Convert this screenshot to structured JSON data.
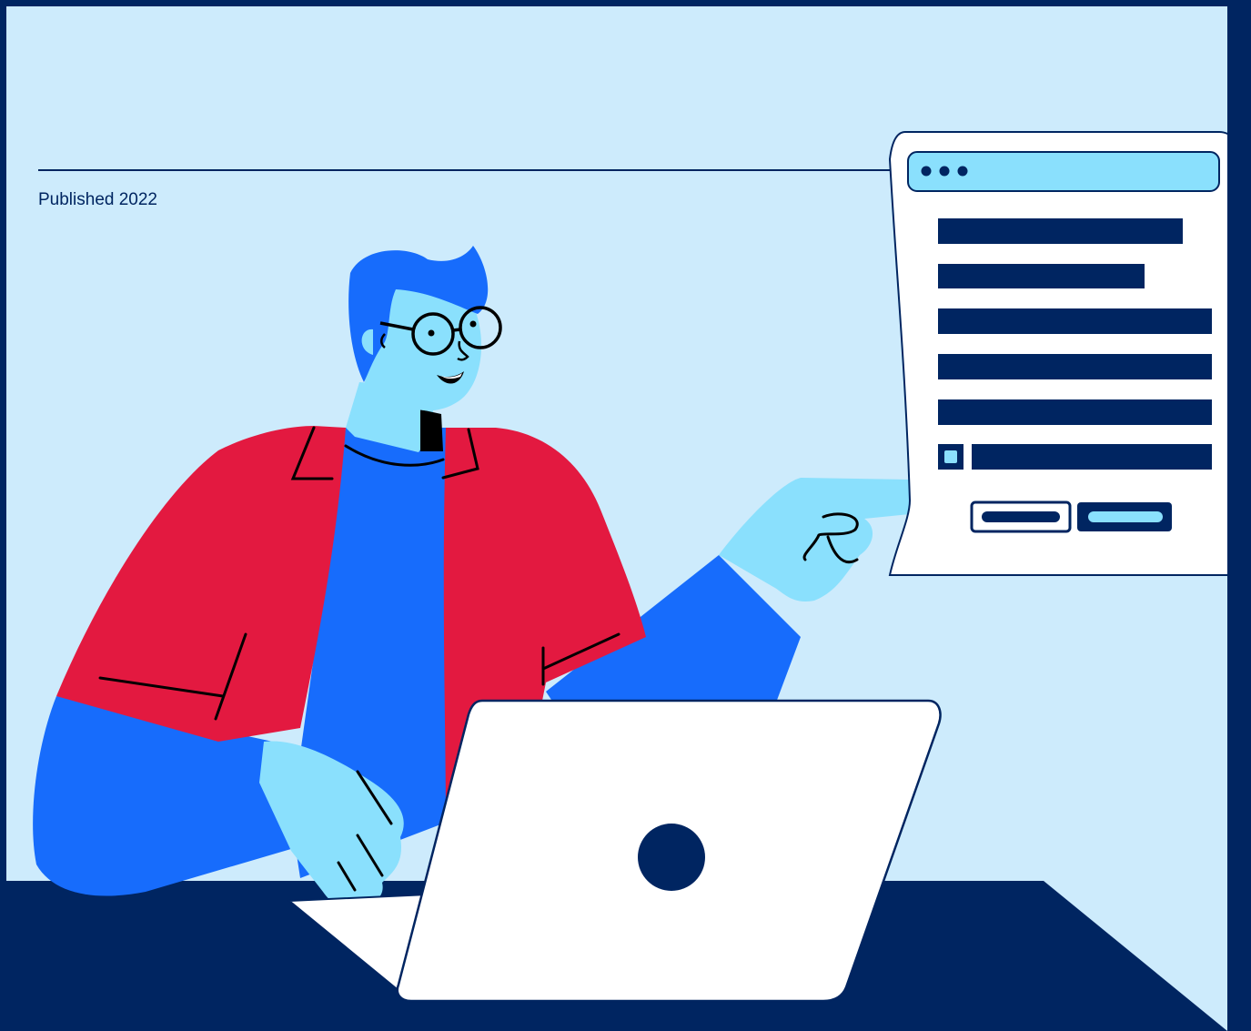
{
  "caption": {
    "published": "Published 2022"
  },
  "colors": {
    "frame_border": "#002561",
    "background": "#cdebfc",
    "jacket": "#e31940",
    "shirt": "#176cfc",
    "skin": "#8ae0fd",
    "navy": "#002561",
    "white": "#ffffff"
  },
  "illustration": {
    "subject": "person-with-glasses-at-laptop-pointing",
    "popup_window": {
      "title_bar_dots": 3,
      "form_lines": 5,
      "has_checkbox": true,
      "buttons": [
        "cancel-button",
        "submit-button"
      ]
    }
  }
}
